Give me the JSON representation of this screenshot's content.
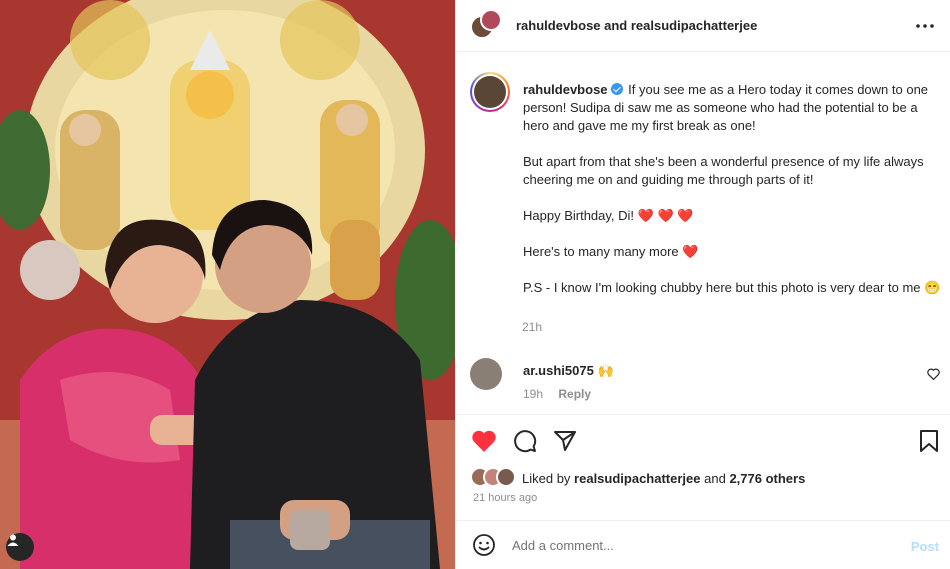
{
  "post": {
    "photo_alt": "",
    "header": {
      "names": "rahuldevbose and realsudipachatterjee"
    },
    "caption": {
      "username": "rahuldevbose",
      "line1": "If you see me as a Hero today it comes down to one person! Sudipa di saw me as someone who had the potential to be a hero and gave me my first break as one!",
      "line2": "But apart from that she's been a wonderful presence of my life always cheering me on and guiding me through parts of it!",
      "line3": "Happy Birthday, Di!",
      "line3_emoji": "❤️ ❤️ ❤️",
      "line4": "Here's to many many more",
      "line4_emoji": "❤️",
      "line5": "P.S - I know I'm looking chubby here but this photo is very dear to me",
      "line5_emoji": "😁",
      "time": "21h"
    },
    "comment": {
      "username": "ar.ushi5075",
      "emoji": "🙌",
      "time": "19h",
      "reply_label": "Reply"
    },
    "likes": {
      "prefix": "Liked by",
      "user": "realsudipachatterjee",
      "middle": "and",
      "others": "2,776 others"
    },
    "post_time": "21 hours ago",
    "add_comment": {
      "placeholder": "Add a comment...",
      "post_label": "Post"
    }
  },
  "icons": {
    "more": "more-horizontal-icon",
    "verified": "verified-badge-icon",
    "like": "heart-filled-icon",
    "comment": "comment-icon",
    "share": "share-icon",
    "save": "bookmark-icon",
    "emoji": "emoji-icon",
    "tag": "user-tag-icon"
  },
  "colors": {
    "like_red": "#ff3040",
    "verified_blue": "#3897f0",
    "post_disabled": "#b2dffc"
  }
}
